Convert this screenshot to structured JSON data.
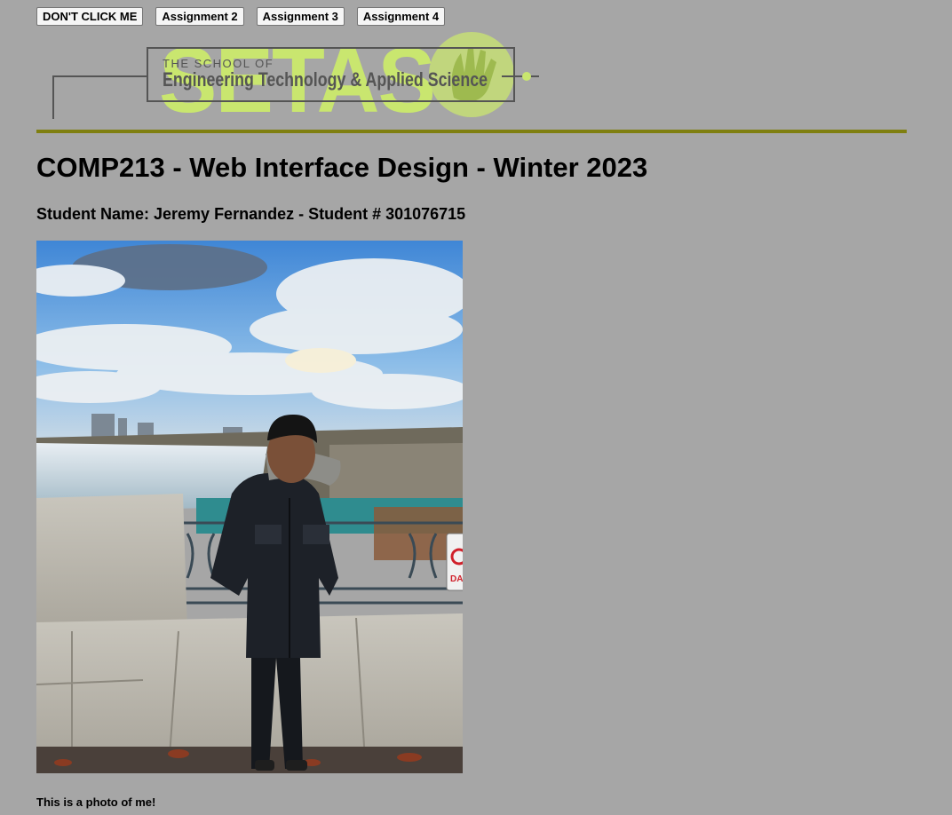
{
  "nav": {
    "buttons": [
      {
        "label": "DON'T CLICK ME"
      },
      {
        "label": "Assignment 2"
      },
      {
        "label": "Assignment 3"
      },
      {
        "label": "Assignment 4"
      }
    ]
  },
  "logo": {
    "big_letters": "SETAS",
    "line1": "THE SCHOOL OF",
    "line2": "Engineering Technology & Applied Science",
    "accent_color": "#c9e66f",
    "frame_color": "#555555"
  },
  "header": {
    "title": "COMP213 - Web Interface Design - Winter 2023",
    "student_line": "Student Name: Jeremy Fernandez - Student # 301076715"
  },
  "photo": {
    "caption": "This is a photo of me!",
    "sign_text": "DA"
  },
  "colors": {
    "background": "#a6a6a6",
    "rule": "#7f7f10"
  }
}
